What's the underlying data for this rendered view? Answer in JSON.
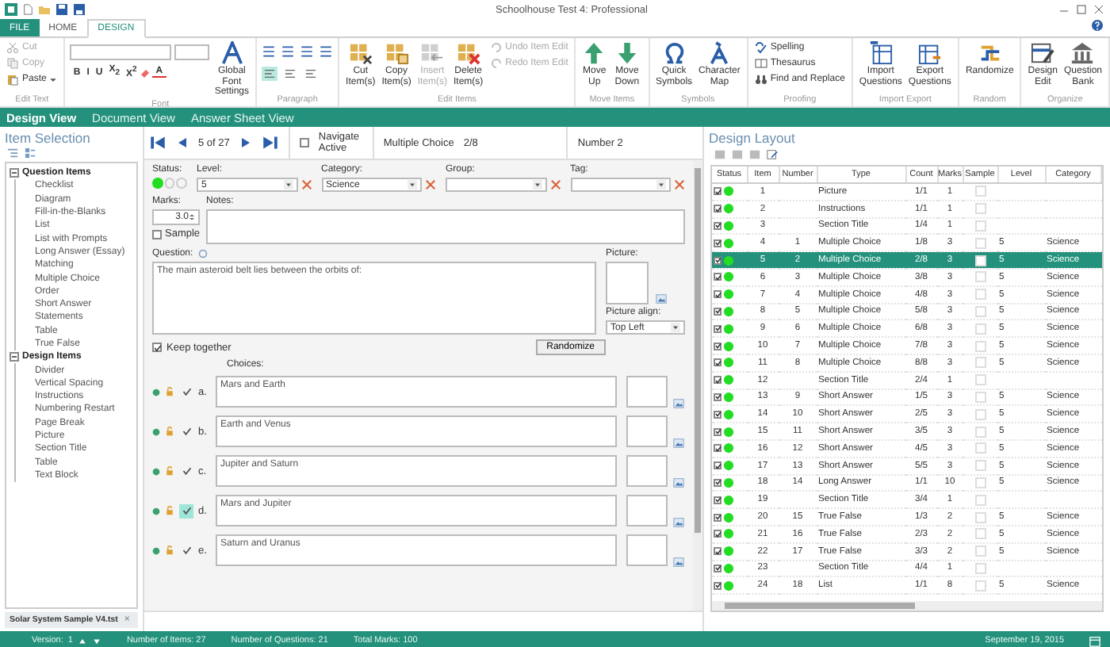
{
  "window": {
    "title": "Schoolhouse Test 4: Professional"
  },
  "menu_tabs": [
    {
      "label": "FILE",
      "kind": "file",
      "selected": false
    },
    {
      "label": "HOME",
      "kind": "tab",
      "selected": false
    },
    {
      "label": "DESIGN",
      "kind": "tab",
      "selected": true
    }
  ],
  "ribbon": [
    {
      "label": "Edit Text",
      "kind": "buttons",
      "items": [
        {
          "kind": "small",
          "label": "Cut",
          "disabled": true
        },
        {
          "kind": "small",
          "label": "Copy",
          "disabled": true
        },
        {
          "kind": "small",
          "label": "Paste",
          "disabled": false,
          "dropdown": true
        }
      ]
    },
    {
      "label": "Font",
      "kind": "font",
      "format_buttons": [
        "B",
        "I",
        "U",
        "X$_{2}$",
        "X$^{2}$"
      ],
      "font_color": "A",
      "items": [
        {
          "kind": "large",
          "label": "Global Font Settings",
          "disabled": false
        }
      ]
    },
    {
      "label": "Paragraph",
      "kind": "paragraph",
      "alignments": [
        {
          "selected": true
        },
        {
          "selected": false
        },
        {
          "selected": false
        }
      ]
    },
    {
      "label": "Edit Items",
      "kind": "buttons",
      "items": [
        {
          "kind": "large",
          "label": "Cut Item(s)",
          "disabled": false
        },
        {
          "kind": "large",
          "label": "Copy Item(s)",
          "disabled": false
        },
        {
          "kind": "large",
          "label": "Insert Item(s)",
          "disabled": true
        },
        {
          "kind": "large",
          "label": "Delete Item(s)",
          "disabled": false
        },
        {
          "kind": "small",
          "label": "Undo Item Edit",
          "disabled": true
        },
        {
          "kind": "small",
          "label": "Redo Item Edit",
          "disabled": true
        }
      ]
    },
    {
      "label": "Move Items",
      "kind": "buttons",
      "items": [
        {
          "kind": "large",
          "label": "Move Up",
          "disabled": false
        },
        {
          "kind": "large",
          "label": "Move Down",
          "disabled": false
        }
      ]
    },
    {
      "label": "Symbols",
      "kind": "buttons",
      "items": [
        {
          "kind": "large",
          "label": "Quick Symbols",
          "disabled": false
        },
        {
          "kind": "large",
          "label": "Character Map",
          "disabled": false
        }
      ]
    },
    {
      "label": "Proofing",
      "kind": "buttons",
      "items": [
        {
          "kind": "small",
          "label": "Spelling",
          "disabled": false
        },
        {
          "kind": "small",
          "label": "Thesaurus",
          "disabled": false
        },
        {
          "kind": "small",
          "label": "Find and Replace",
          "disabled": false
        }
      ]
    },
    {
      "label": "Import  Export",
      "kind": "buttons",
      "items": [
        {
          "kind": "large",
          "label": "Import Questions",
          "disabled": false
        },
        {
          "kind": "large",
          "label": "Export Questions",
          "disabled": false
        }
      ]
    },
    {
      "label": "Random",
      "kind": "buttons",
      "items": [
        {
          "kind": "large",
          "label": "Randomize",
          "disabled": false
        }
      ]
    },
    {
      "label": "Organize",
      "kind": "buttons",
      "items": [
        {
          "kind": "large",
          "label": "Design Edit",
          "disabled": false
        },
        {
          "kind": "large",
          "label": "Question Bank",
          "disabled": false
        }
      ]
    }
  ],
  "view_tabs": [
    {
      "label": "Design View",
      "selected": true
    },
    {
      "label": "Document View",
      "selected": false
    },
    {
      "label": "Answer Sheet View",
      "selected": false
    }
  ],
  "item_selection": {
    "title": "Item Selection",
    "tree": [
      {
        "label": "Question Items",
        "expanded": true,
        "children": [
          {
            "label": "Checklist"
          },
          {
            "label": "Diagram"
          },
          {
            "label": "Fill-in-the-Blanks"
          },
          {
            "label": "List"
          },
          {
            "label": "List with Prompts"
          },
          {
            "label": "Long Answer (Essay)"
          },
          {
            "label": "Matching"
          },
          {
            "label": "Multiple Choice"
          },
          {
            "label": "Order"
          },
          {
            "label": "Short Answer"
          },
          {
            "label": "Statements"
          },
          {
            "label": "Table"
          },
          {
            "label": "True False"
          }
        ]
      },
      {
        "label": "Design Items",
        "expanded": true,
        "children": [
          {
            "label": "Divider"
          },
          {
            "label": "Vertical Spacing"
          },
          {
            "label": "Instructions"
          },
          {
            "label": "Numbering Restart"
          },
          {
            "label": "Page Break"
          },
          {
            "label": "Picture"
          },
          {
            "label": "Section Title"
          },
          {
            "label": "Table"
          },
          {
            "label": "Text Block"
          }
        ]
      }
    ],
    "document_tab": {
      "label": "Solar System Sample V4.tst",
      "close": "×"
    }
  },
  "editor": {
    "nav": {
      "position": "5 of 27",
      "navigate_label": "Navigate Active",
      "navigate_active": false,
      "type": "Multiple Choice",
      "count": "2/8",
      "number": "Number 2"
    },
    "status": {
      "label": "Status:",
      "options": [
        {
          "selected": true
        },
        {
          "selected": false
        },
        {
          "selected": false
        }
      ]
    },
    "fields": [
      {
        "label": "Level:",
        "value": "5"
      },
      {
        "label": "Category:",
        "value": "Science"
      },
      {
        "label": "Group:"
      },
      {
        "label": "Tag:"
      }
    ],
    "marks": {
      "label": "Marks:",
      "value": "3.0"
    },
    "sample": {
      "label": "Sample",
      "checked": false
    },
    "notes": {
      "label": "Notes:"
    },
    "question": {
      "label": "Question:",
      "value": "The main asteroid belt lies between the orbits of:"
    },
    "picture": {
      "label": "Picture:"
    },
    "picture_align": {
      "label": "Picture align:",
      "value": "Top Left"
    },
    "keep_together": {
      "label": "Keep together",
      "checked": true
    },
    "randomize_button": "Randomize",
    "choices": {
      "label": "Choices:",
      "items": [
        {
          "letter": "a.",
          "text": "Mars and Earth",
          "correct": false
        },
        {
          "letter": "b.",
          "text": "Earth and Venus",
          "correct": false
        },
        {
          "letter": "c.",
          "text": "Jupiter and Saturn",
          "correct": false
        },
        {
          "letter": "d.",
          "text": "Mars and Jupiter",
          "correct": true
        },
        {
          "letter": "e.",
          "text": "Saturn and Uranus",
          "correct": false
        }
      ]
    }
  },
  "design_layout": {
    "title": "Design Layout",
    "columns": [
      "Status",
      "Item",
      "Number",
      "Type",
      "Count",
      "Marks",
      "Sample",
      "Level",
      "Category"
    ],
    "rows": [
      {
        "checked": true,
        "item": "1",
        "type": "Picture",
        "count": "1/1",
        "marks": "1",
        "sample": false,
        "selected": false
      },
      {
        "checked": true,
        "item": "2",
        "type": "Instructions",
        "count": "1/1",
        "marks": "1",
        "sample": false,
        "selected": false
      },
      {
        "checked": true,
        "item": "3",
        "type": "Section Title",
        "count": "1/4",
        "marks": "1",
        "sample": false,
        "selected": false
      },
      {
        "checked": true,
        "item": "4",
        "number": "1",
        "type": "Multiple Choice",
        "count": "1/8",
        "marks": "3",
        "sample": false,
        "level": "5",
        "category": "Science",
        "selected": false
      },
      {
        "checked": true,
        "item": "5",
        "number": "2",
        "type": "Multiple Choice",
        "count": "2/8",
        "marks": "3",
        "sample": false,
        "level": "5",
        "category": "Science",
        "selected": true
      },
      {
        "checked": true,
        "item": "6",
        "number": "3",
        "type": "Multiple Choice",
        "count": "3/8",
        "marks": "3",
        "sample": false,
        "level": "5",
        "category": "Science",
        "selected": false
      },
      {
        "checked": true,
        "item": "7",
        "number": "4",
        "type": "Multiple Choice",
        "count": "4/8",
        "marks": "3",
        "sample": false,
        "level": "5",
        "category": "Science",
        "selected": false
      },
      {
        "checked": true,
        "item": "8",
        "number": "5",
        "type": "Multiple Choice",
        "count": "5/8",
        "marks": "3",
        "sample": false,
        "level": "5",
        "category": "Science",
        "selected": false
      },
      {
        "checked": true,
        "item": "9",
        "number": "6",
        "type": "Multiple Choice",
        "count": "6/8",
        "marks": "3",
        "sample": false,
        "level": "5",
        "category": "Science",
        "selected": false
      },
      {
        "checked": true,
        "item": "10",
        "number": "7",
        "type": "Multiple Choice",
        "count": "7/8",
        "marks": "3",
        "sample": false,
        "level": "5",
        "category": "Science",
        "selected": false
      },
      {
        "checked": true,
        "item": "11",
        "number": "8",
        "type": "Multiple Choice",
        "count": "8/8",
        "marks": "3",
        "sample": false,
        "level": "5",
        "category": "Science",
        "selected": false
      },
      {
        "checked": true,
        "item": "12",
        "type": "Section Title",
        "count": "2/4",
        "marks": "1",
        "sample": false,
        "selected": false
      },
      {
        "checked": true,
        "item": "13",
        "number": "9",
        "type": "Short Answer",
        "count": "1/5",
        "marks": "3",
        "sample": false,
        "level": "5",
        "category": "Science",
        "selected": false
      },
      {
        "checked": true,
        "item": "14",
        "number": "10",
        "type": "Short Answer",
        "count": "2/5",
        "marks": "3",
        "sample": false,
        "level": "5",
        "category": "Science",
        "selected": false
      },
      {
        "checked": true,
        "item": "15",
        "number": "11",
        "type": "Short Answer",
        "count": "3/5",
        "marks": "3",
        "sample": false,
        "level": "5",
        "category": "Science",
        "selected": false
      },
      {
        "checked": true,
        "item": "16",
        "number": "12",
        "type": "Short Answer",
        "count": "4/5",
        "marks": "3",
        "sample": false,
        "level": "5",
        "category": "Science",
        "selected": false
      },
      {
        "checked": true,
        "item": "17",
        "number": "13",
        "type": "Short Answer",
        "count": "5/5",
        "marks": "3",
        "sample": false,
        "level": "5",
        "category": "Science",
        "selected": false
      },
      {
        "checked": true,
        "item": "18",
        "number": "14",
        "type": "Long Answer",
        "count": "1/1",
        "marks": "10",
        "sample": false,
        "level": "5",
        "category": "Science",
        "selected": false
      },
      {
        "checked": true,
        "item": "19",
        "type": "Section Title",
        "count": "3/4",
        "marks": "1",
        "sample": false,
        "selected": false
      },
      {
        "checked": true,
        "item": "20",
        "number": "15",
        "type": "True False",
        "count": "1/3",
        "marks": "2",
        "sample": false,
        "level": "5",
        "category": "Science",
        "selected": false
      },
      {
        "checked": true,
        "item": "21",
        "number": "16",
        "type": "True False",
        "count": "2/3",
        "marks": "2",
        "sample": false,
        "level": "5",
        "category": "Science",
        "selected": false
      },
      {
        "checked": true,
        "item": "22",
        "number": "17",
        "type": "True False",
        "count": "3/3",
        "marks": "2",
        "sample": false,
        "level": "5",
        "category": "Science",
        "selected": false
      },
      {
        "checked": true,
        "item": "23",
        "type": "Section Title",
        "count": "4/4",
        "marks": "1",
        "sample": false,
        "selected": false
      },
      {
        "checked": true,
        "item": "24",
        "number": "18",
        "type": "List",
        "count": "1/1",
        "marks": "8",
        "sample": false,
        "level": "5",
        "category": "Science",
        "selected": false
      }
    ]
  },
  "status_bar": {
    "version_label": "Version:",
    "version": "1",
    "items": [
      "Number of Items: 27",
      "Number of Questions: 21",
      "Total Marks: 100"
    ],
    "date": "September 19, 2015"
  }
}
